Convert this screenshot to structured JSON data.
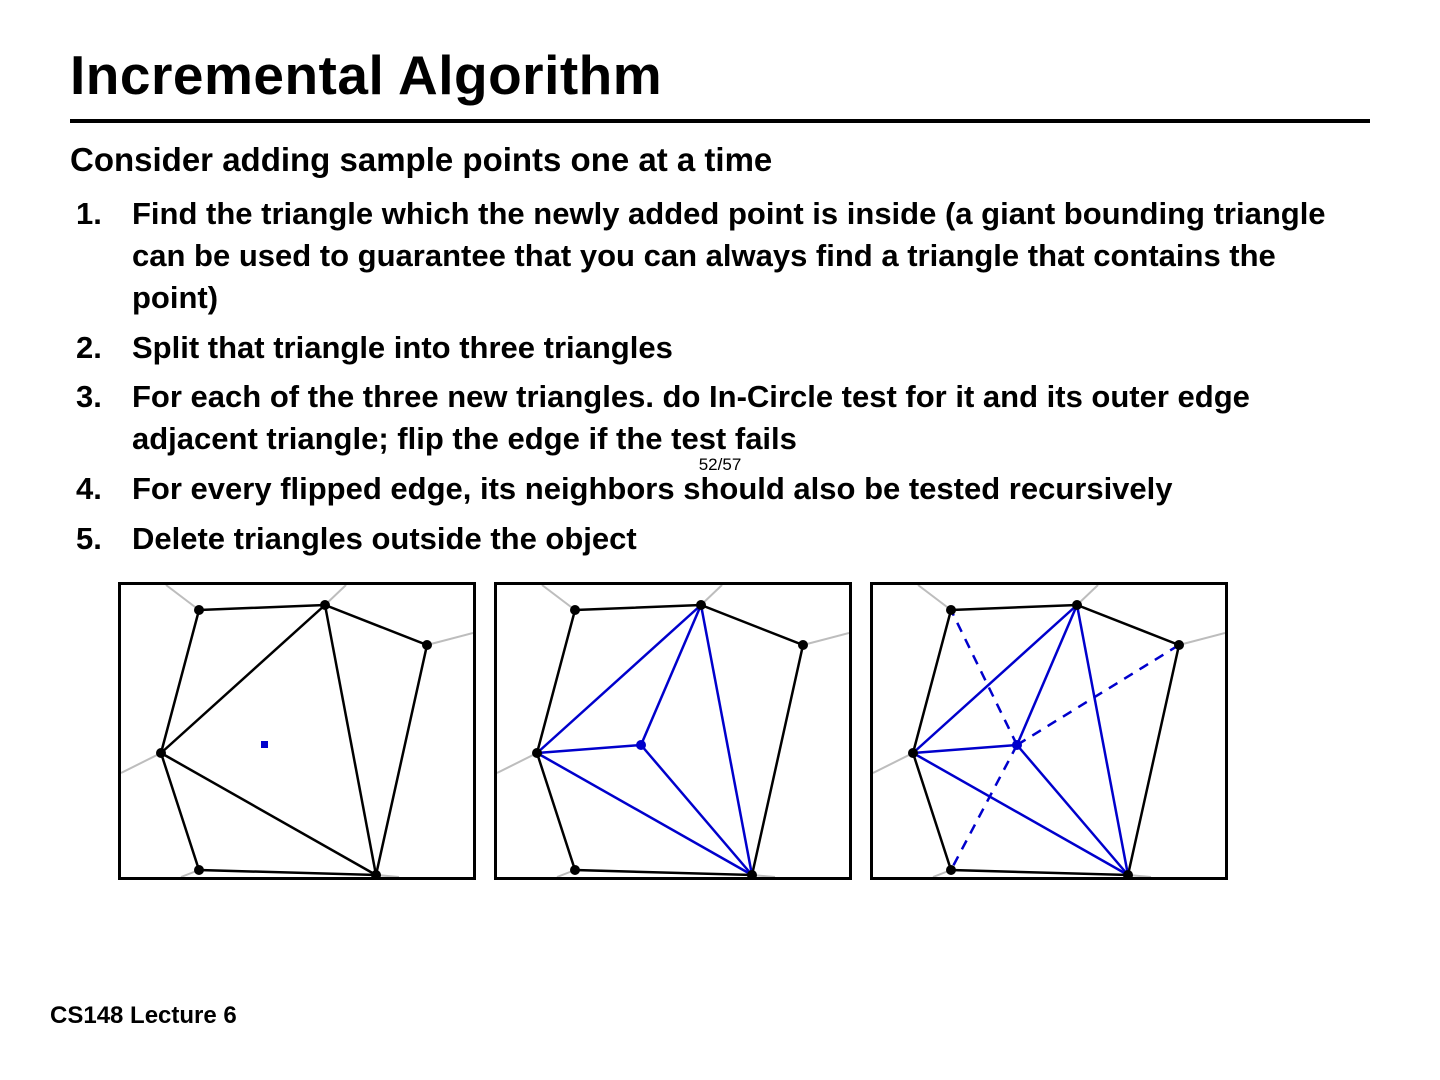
{
  "slide": {
    "title": "Incremental Algorithm",
    "subtitle": "Consider adding sample points one at a time",
    "steps": [
      "Find the triangle which the newly added point is inside (a giant bounding triangle can be used to guarantee that you can always find a triangle that contains the point)",
      "Split that triangle into three triangles",
      "For each of the three new triangles. do In-Circle test for it and its outer edge adjacent triangle; flip the edge if the test fails",
      "For every flipped edge, its neighbors should also be tested recursively",
      "Delete triangles outside the object"
    ],
    "page_overlay": "52/57",
    "footer": "CS148 Lecture 6"
  }
}
